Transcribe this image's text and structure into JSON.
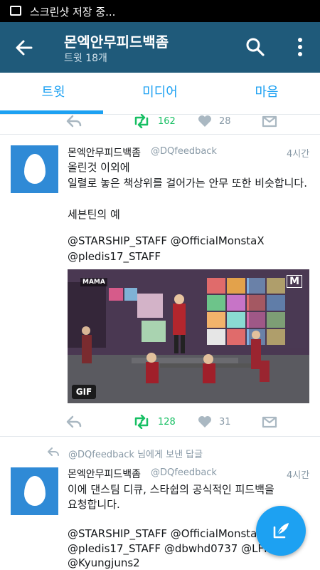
{
  "status_bar": {
    "notification_text": "스크린샷 저장 중...",
    "icon": "image-icon"
  },
  "app_bar": {
    "title": "몬엑안무피드백좀",
    "subtitle": "트윗 18개",
    "back_icon": "arrow-back-icon",
    "search_icon": "search-icon",
    "more_icon": "more-vert-icon"
  },
  "tabs": [
    {
      "label": "트윗",
      "selected": true
    },
    {
      "label": "미디어",
      "selected": false
    },
    {
      "label": "마음",
      "selected": false
    }
  ],
  "prev_tweet": {
    "retweet_count": "162",
    "like_count": "28"
  },
  "tweets": [
    {
      "name": "몬엑안무피드백좀",
      "handle": "@DQfeedback",
      "time": "4시간",
      "lines": [
        "올린것 이외에",
        "일렬로 놓은 책상위를 걸어가는 안무 또한 비슷합니다.",
        "",
        "세븐틴의 예",
        "",
        "@STARSHIP_STAFF @OfficialMonstaX",
        "@pledis17_STAFF"
      ],
      "media": {
        "badge": "GIF",
        "watermark": "MAMA",
        "corner_logo": "M"
      },
      "retweet_count": "128",
      "like_count": "31"
    },
    {
      "reply_context": "@DQfeedback 님에게 보낸 답글",
      "name": "몬엑안무피드백좀",
      "handle": "@DQfeedback",
      "time": "4시간",
      "lines": [
        "이에 댄스팀 디큐, 스타쉽의 공식적인 피드백을",
        "요청합니다.",
        "",
        "@STARSHIP_STAFF @OfficialMonstaX",
        "@pledis17_STAFF @dbwhd0737 @LFH",
        "@Kyungjuns2"
      ]
    }
  ],
  "fab": {
    "icon": "compose-tweet-icon"
  },
  "colors": {
    "app_bar": "#1f5a7a",
    "accent": "#1da1f2",
    "retweet": "#17bf63",
    "muted": "#8899a6"
  }
}
